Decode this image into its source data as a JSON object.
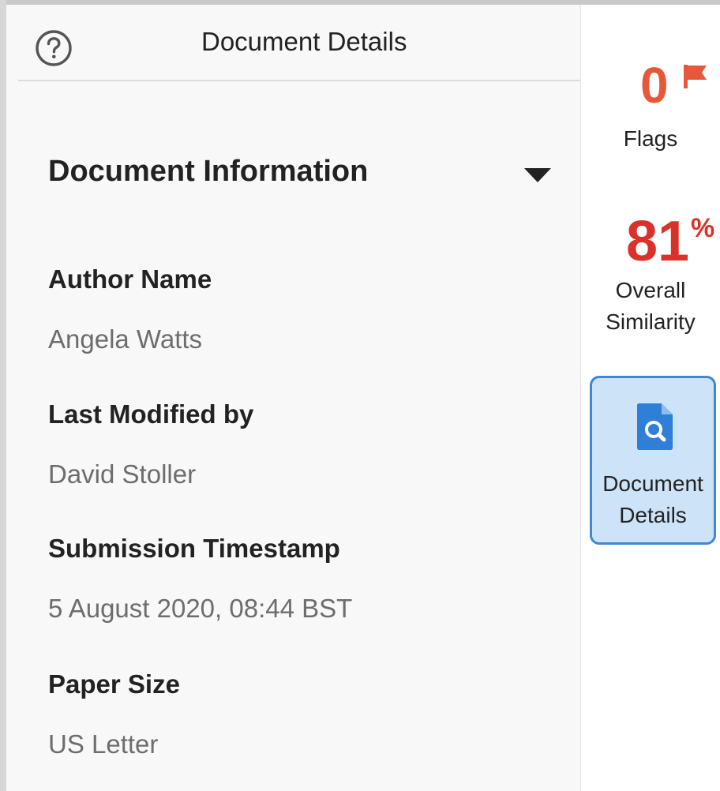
{
  "panel": {
    "title": "Document Details",
    "section_title": "Document Information",
    "fields": [
      {
        "label": "Author Name",
        "value": "Angela Watts"
      },
      {
        "label": "Last Modified by",
        "value": "David Stoller"
      },
      {
        "label": "Submission Timestamp",
        "value": "5 August 2020, 08:44 BST"
      },
      {
        "label": "Paper Size",
        "value": "US Letter"
      }
    ]
  },
  "rail": {
    "flags_count": "0",
    "flags_label": "Flags",
    "similarity_value": "81",
    "similarity_unit": "%",
    "similarity_label_1": "Overall",
    "similarity_label_2": "Similarity",
    "details_label_1": "Document",
    "details_label_2": "Details"
  },
  "icons": {
    "help": "question-circle-icon",
    "caret": "caret-down-icon",
    "flag": "flag-icon",
    "details": "document-search-icon"
  },
  "colors": {
    "flags": "#e7583b",
    "similarity": "#d8322a",
    "active_button_bg": "#cce3f8",
    "active_button_border": "#3f86d6",
    "document_icon": "#2f7ed8"
  }
}
